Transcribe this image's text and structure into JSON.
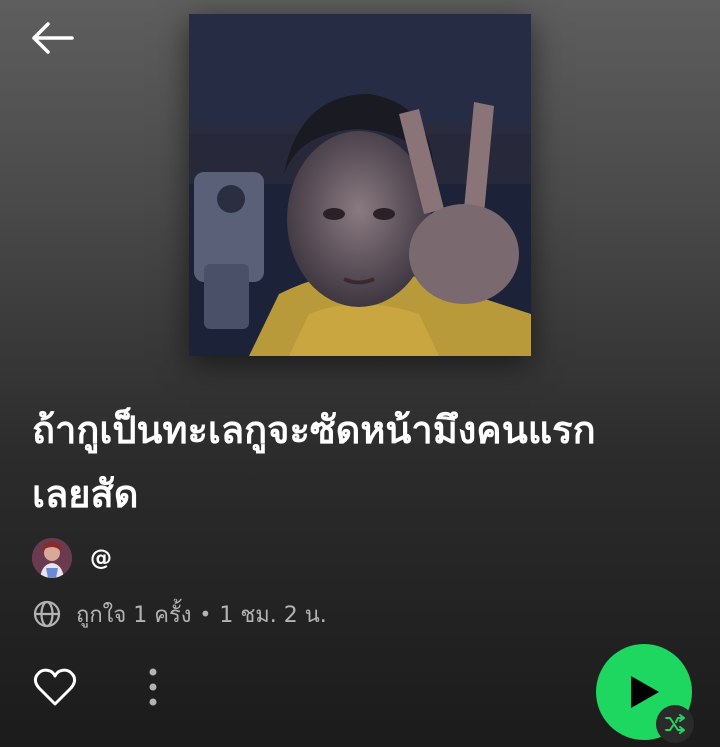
{
  "header": {
    "back_icon": "arrow-left-icon"
  },
  "playlist": {
    "title": "ถ้ากูเป็นทะเลกูจะซัดหน้ามึงคนแรกเลยสัด",
    "owner_name": "@",
    "visibility_icon": "globe-icon",
    "likes": "ถูกใจ 1 ครั้ง",
    "separator": "•",
    "duration": "1 ชม. 2 น."
  },
  "actions": {
    "like_icon": "heart-outline-icon",
    "more_icon": "more-vertical-icon",
    "play_icon": "play-icon",
    "shuffle_icon": "shuffle-icon"
  },
  "colors": {
    "accent": "#1ed760",
    "text_primary": "#ffffff",
    "text_secondary": "#b3b3b3"
  }
}
